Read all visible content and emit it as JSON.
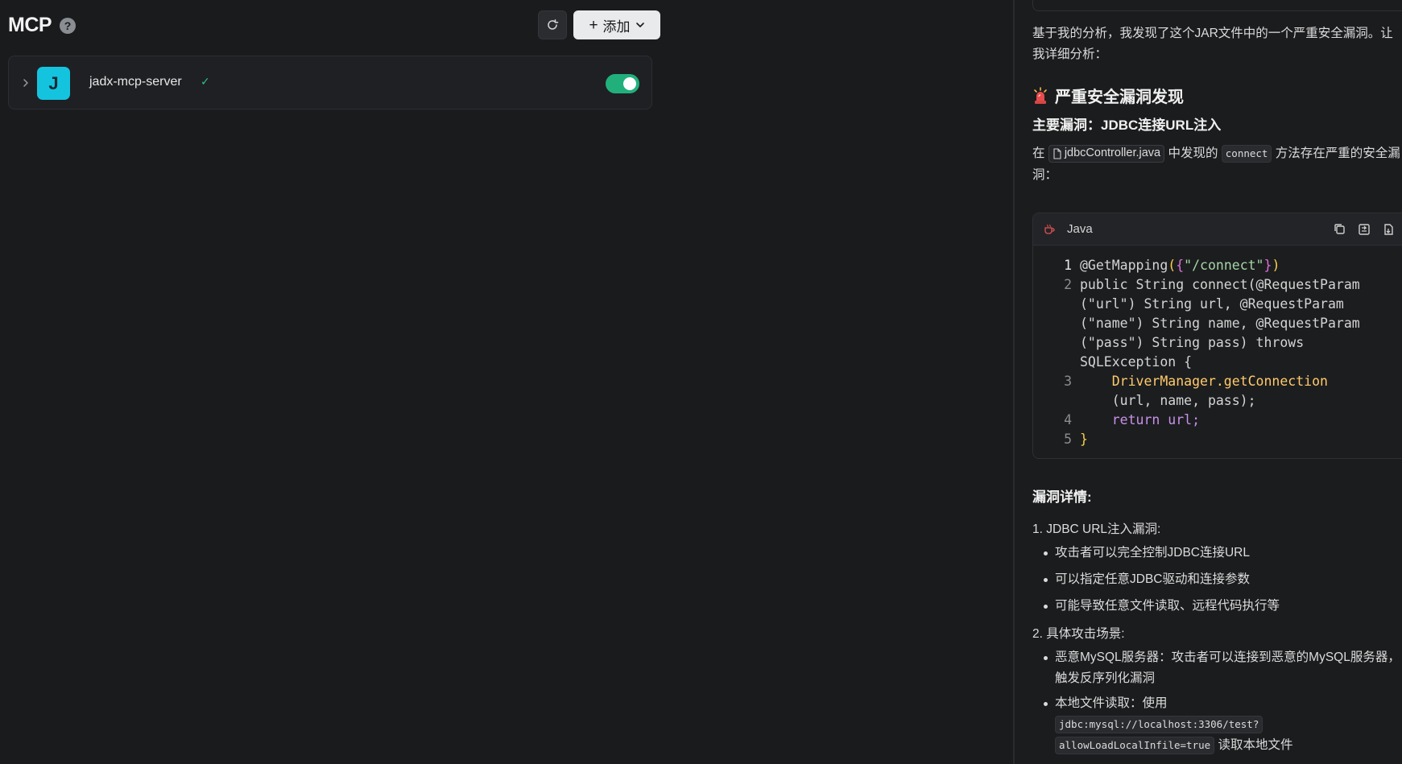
{
  "mcp": {
    "title": "MCP",
    "help_glyph": "?",
    "add_label": "添加",
    "servers": [
      {
        "initial": "J",
        "name": "jadx-mcp-server",
        "status": "✓",
        "enabled": true
      }
    ]
  },
  "chat": {
    "intro": "基于我的分析，我发现了这个JAR文件中的一个严重安全漏洞。让我详细分析：",
    "heading": "严重安全漏洞发现",
    "subheading": "主要漏洞：JDBC连接URL注入",
    "desc_prefix": "在",
    "desc_file": "jdbcController.java",
    "desc_mid": "中发现的",
    "desc_code": "connect",
    "desc_suffix": "方法存在严重的安全漏洞：",
    "code": {
      "language": "Java",
      "lines": [
        {
          "n": "1",
          "seg": [
            "@GetMapping",
            "(",
            "{",
            "\"/connect\"",
            "}",
            ")"
          ]
        },
        {
          "n": "2",
          "text": "public String connect(@RequestParam"
        },
        {
          "n": "",
          "text": "(\"url\") String url, @RequestParam"
        },
        {
          "n": "",
          "text": "(\"name\") String name, @RequestParam"
        },
        {
          "n": "",
          "text": "(\"pass\") String pass) throws"
        },
        {
          "n": "",
          "text": "SQLException {"
        },
        {
          "n": "3",
          "text": "    DriverManager.getConnection"
        },
        {
          "n": "",
          "text": "    (url, name, pass);"
        },
        {
          "n": "4",
          "text": "    return url;"
        },
        {
          "n": "5",
          "text": "}"
        }
      ]
    },
    "details_heading": "漏洞详情:",
    "list": [
      {
        "num": "1.",
        "title": "JDBC URL注入漏洞:",
        "bullets": [
          "攻击者可以完全控制JDBC连接URL",
          "可以指定任意JDBC驱动和连接参数",
          "可能导致任意文件读取、远程代码执行等"
        ]
      },
      {
        "num": "2.",
        "title": "具体攻击场景:",
        "bullets": [
          "恶意MySQL服务器：攻击者可以连接到恶意的MySQL服务器，触发反序列化漏洞",
          "本地文件读取：使用"
        ]
      }
    ],
    "local_file_code_1": "jdbc:mysql://localhost:3306/test?",
    "local_file_code_2": "allowLoadLocalInfile=true",
    "local_file_suffix": "读取本地文件"
  }
}
